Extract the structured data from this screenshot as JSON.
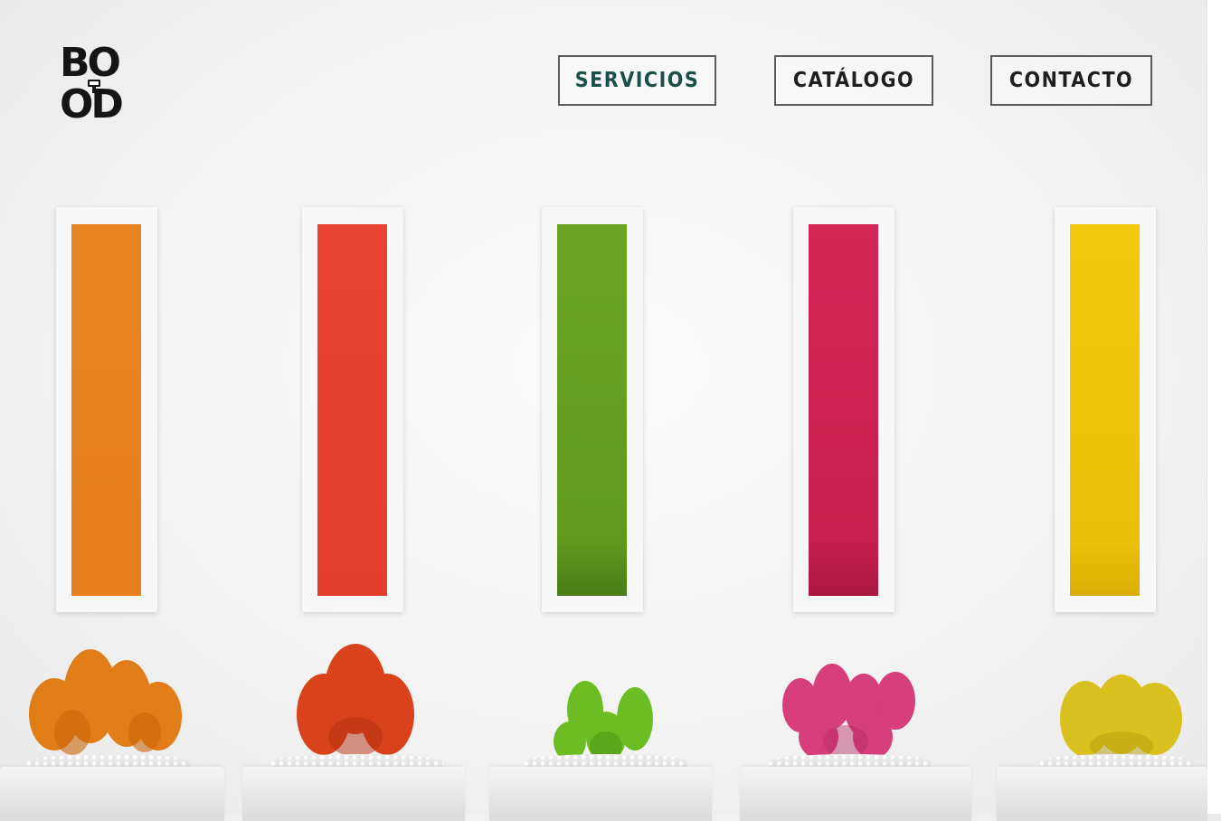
{
  "logo": {
    "line1": "BO",
    "line2": "OD"
  },
  "nav": {
    "items": [
      {
        "label": "SERVICIOS",
        "active": true
      },
      {
        "label": "CATÁLOGO",
        "active": false
      },
      {
        "label": "CONTACTO",
        "active": false
      }
    ]
  },
  "colors": {
    "active_nav": "#1c4f4a",
    "panels": [
      "#e8851f",
      "#eb4431",
      "#68a221",
      "#d42657",
      "#f2c80a"
    ]
  },
  "icons": [
    "logo-plug-icon"
  ]
}
